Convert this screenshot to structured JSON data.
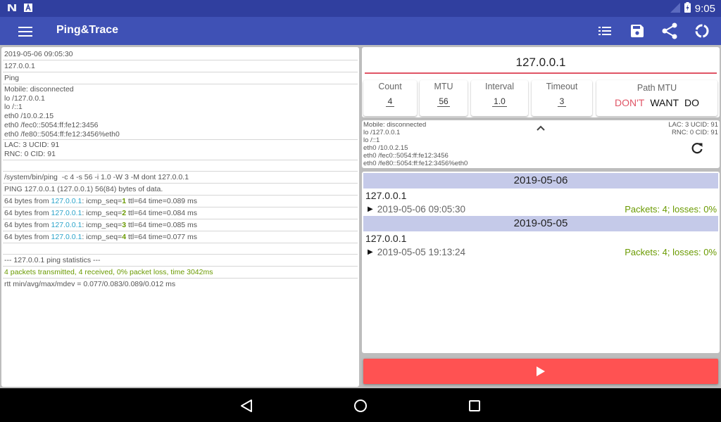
{
  "status_bar": {
    "time": "9:05",
    "icons": [
      "notification-n-icon",
      "notification-a-icon",
      "signal-icon",
      "battery-charging-icon"
    ]
  },
  "app_bar": {
    "title": "Ping&Trace",
    "menu_icon": "hamburger-menu-icon",
    "actions": [
      {
        "name": "list-icon"
      },
      {
        "name": "save-icon"
      },
      {
        "name": "share-icon"
      },
      {
        "name": "progress-circle-icon"
      }
    ]
  },
  "log": {
    "header_lines": [
      "2019-05-06 09:05:30",
      "127.0.0.1",
      "Ping"
    ],
    "network_block": [
      "Mobile: disconnected",
      "lo /127.0.0.1",
      "lo /::1",
      "eth0 /10.0.2.15",
      "eth0 /fec0::5054:ff:fe12:3456",
      "eth0 /fe80::5054:ff:fe12:3456%eth0"
    ],
    "cell_block": [
      "LAC: 3 UCID: 91",
      "RNC: 0 CID: 91"
    ],
    "command": "/system/bin/ping  -c 4 -s 56 -i 1.0 -W 3 -M dont 127.0.0.1",
    "ping_header": "PING 127.0.0.1 (127.0.0.1) 56(84) bytes of data.",
    "replies": [
      {
        "prefix": "64 bytes from ",
        "ip": "127.0.0.1",
        "mid": ": icmp_seq=",
        "seq": "1",
        "suffix": " ttl=64 time=0.089 ms"
      },
      {
        "prefix": "64 bytes from ",
        "ip": "127.0.0.1",
        "mid": ": icmp_seq=",
        "seq": "2",
        "suffix": " ttl=64 time=0.084 ms"
      },
      {
        "prefix": "64 bytes from ",
        "ip": "127.0.0.1",
        "mid": ": icmp_seq=",
        "seq": "3",
        "suffix": " ttl=64 time=0.085 ms"
      },
      {
        "prefix": "64 bytes from ",
        "ip": "127.0.0.1",
        "mid": ": icmp_seq=",
        "seq": "4",
        "suffix": " ttl=64 time=0.077 ms"
      }
    ],
    "stats_header": "--- 127.0.0.1 ping statistics ---",
    "stats_summary": "4 packets transmitted, 4 received, 0% packet loss, time 3042ms",
    "rtt": "rtt min/avg/max/mdev = 0.077/0.083/0.089/0.012 ms"
  },
  "form": {
    "host_value": "127.0.0.1",
    "params": [
      {
        "label": "Count",
        "value": "4"
      },
      {
        "label": "MTU",
        "value": "56"
      },
      {
        "label": "Interval",
        "value": "1.0"
      },
      {
        "label": "Timeout",
        "value": "3"
      }
    ],
    "path_mtu": {
      "label": "Path MTU",
      "options": [
        "DON'T",
        "WANT",
        "DO"
      ],
      "selected": "DON'T"
    }
  },
  "network_info": {
    "lines": [
      "Mobile: disconnected",
      "lo /127.0.0.1",
      "lo /::1",
      "eth0 /10.0.2.15",
      "eth0 /fec0::5054:ff:fe12:3456",
      "eth0 /fe80::5054:ff:fe12:3456%eth0"
    ],
    "cell_lines": [
      "LAC: 3 UCID: 91",
      "RNC: 0 CID: 91"
    ]
  },
  "history": [
    {
      "date": "2019-05-06",
      "host": "127.0.0.1",
      "timestamp": "2019-05-06 09:05:30",
      "result": "Packets: 4; losses: 0%"
    },
    {
      "date": "2019-05-05",
      "host": "127.0.0.1",
      "timestamp": "2019-05-05 19:13:24",
      "result": "Packets: 4; losses: 0%"
    }
  ],
  "start_button": {
    "icon": "play-icon"
  },
  "nav_bar": {
    "buttons": [
      "back-icon",
      "home-icon",
      "recents-icon"
    ]
  },
  "colors": {
    "status_bar": "#303f9f",
    "app_bar": "#3f51b5",
    "accent_red": "#ff5252",
    "date_header": "#c5cae9",
    "success_green": "#6a9a00",
    "ip_blue": "#29a3c9"
  }
}
